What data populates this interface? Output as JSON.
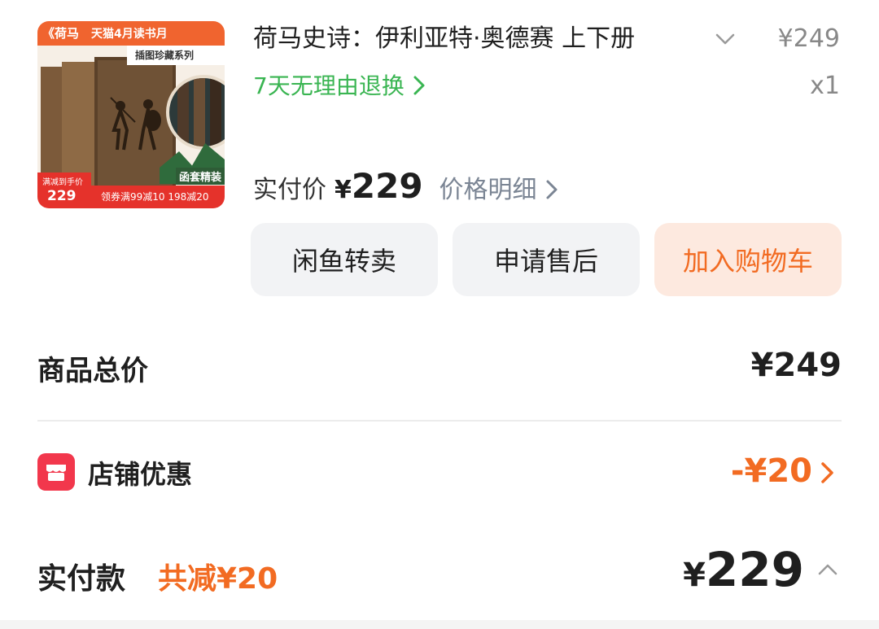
{
  "product": {
    "image": {
      "banner_left": "《荷马",
      "banner_text": "天猫4月读书月",
      "series_tag": "插图珍藏系列",
      "box_label": "函套精装",
      "price_tag_label": "满减到手价",
      "price_tag_value": "229",
      "coupon_text": "领券满99减10 198减20"
    },
    "title": "荷马史诗：伊利亚特·奥德赛 上下册",
    "unit_price": "¥249",
    "return_policy": "7天无理由退换",
    "quantity": "x1",
    "paid_label": "实付价",
    "paid_currency": "¥",
    "paid_amount": "229",
    "price_detail_label": "价格明细"
  },
  "actions": {
    "resell_label": "闲鱼转卖",
    "aftersale_label": "申请售后",
    "cart_label": "加入购物车"
  },
  "summary": {
    "total_label": "商品总价",
    "total_value": "¥249",
    "shop_discount_label": "店铺优惠",
    "shop_discount_value": "-¥20",
    "pay_label": "实付款",
    "pay_discount": "共减¥20",
    "pay_currency": "¥",
    "pay_amount": "229"
  },
  "colors": {
    "accent_orange": "#f26b22",
    "return_green": "#3ab552",
    "shop_icon_red": "#f2374c"
  }
}
